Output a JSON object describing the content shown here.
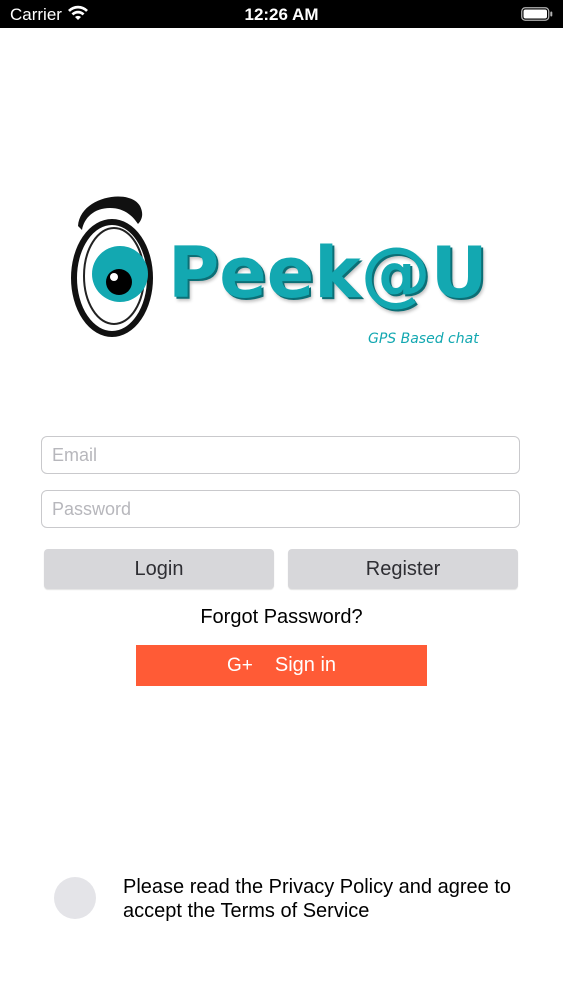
{
  "status_bar": {
    "carrier": "Carrier",
    "time": "12:26 AM",
    "icons": [
      "wifi-icon",
      "battery-icon"
    ]
  },
  "logo": {
    "wordmark": "Peek@U",
    "tagline": "GPS Based chat",
    "icon": "eye-icon",
    "brand_color": "#13a8b1"
  },
  "form": {
    "email_placeholder": "Email",
    "email_value": "",
    "password_placeholder": "Password",
    "password_value": ""
  },
  "buttons": {
    "login_label": "Login",
    "register_label": "Register",
    "forgot_password": "Forgot Password?",
    "google_icon_text": "G+",
    "google_label": "Sign in",
    "google_color": "#ff5b36"
  },
  "privacy": {
    "text": "Please read the Privacy Policy and agree to accept the Terms of Service",
    "checked": false
  }
}
